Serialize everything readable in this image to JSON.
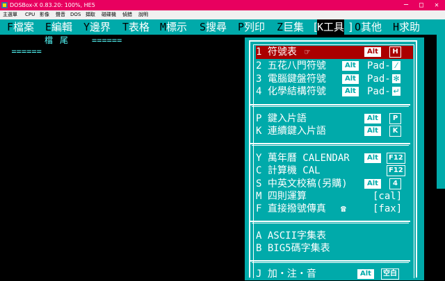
{
  "window": {
    "title": "DOSBox-X 0.83.20: 100%, HE5"
  },
  "menubar": {
    "items": [
      "主選單",
      "CPU",
      "影像",
      "聲音",
      "DOS",
      "擷取",
      "磁碟機",
      "偵錯",
      "說明"
    ]
  },
  "dos_menu": {
    "items": [
      {
        "hotkey": "F",
        "label": "檔案",
        "selected": false
      },
      {
        "hotkey": "E",
        "label": "編輯",
        "selected": false
      },
      {
        "hotkey": "Y",
        "label": "邊界",
        "selected": false
      },
      {
        "hotkey": "T",
        "label": "表格",
        "selected": false
      },
      {
        "hotkey": "M",
        "label": "標示",
        "selected": false
      },
      {
        "hotkey": "S",
        "label": "搜尋",
        "selected": false
      },
      {
        "hotkey": "P",
        "label": "列印",
        "selected": false
      },
      {
        "hotkey": "Z",
        "label": "巨集",
        "selected": false
      },
      {
        "hotkey": "K",
        "label": "工具",
        "selected": true
      },
      {
        "hotkey": "O",
        "label": "其他",
        "selected": false
      },
      {
        "hotkey": "H",
        "label": "求助",
        "selected": false
      }
    ],
    "open_bracket": "[",
    "close_bracket": "]"
  },
  "editor": {
    "eof_marks_left": "======",
    "eof_label": "檔尾",
    "eof_marks_right": "======"
  },
  "tools_menu": {
    "rows": [
      {
        "label": "1 符號表",
        "icon": "☞",
        "mod": "Alt",
        "key": "H",
        "selected": true
      },
      {
        "label": "2 五花八門符號",
        "mod": "Alt",
        "key": "Pad-",
        "pad": "⁄"
      },
      {
        "label": "3 電腦鍵盤符號",
        "mod": "Alt",
        "key": "Pad-",
        "pad": "✻"
      },
      {
        "label": "4 化學結構符號",
        "mod": "Alt",
        "key": "Pad-",
        "pad": "↵"
      },
      {
        "label": "P 鍵入片語",
        "mod": "Alt",
        "key": "P"
      },
      {
        "label": "K 連續鍵入片語",
        "mod": "Alt",
        "key": "K"
      },
      {
        "label": "Y 萬年曆 CALENDAR",
        "mod": "Alt",
        "key": "F12"
      },
      {
        "label": "C 計算機 CAL",
        "key": "F12"
      },
      {
        "label": "S 中英文校稿(另購)",
        "mod": "Alt",
        "key": "4"
      },
      {
        "label": "M 四則運算",
        "key": "[cal]"
      },
      {
        "label": "F 直接撥號傳真",
        "icon": "☎",
        "key": "[fax]"
      },
      {
        "label": "A ASCII字集表"
      },
      {
        "label": "B BIG5碼字集表"
      },
      {
        "label": "J 加‧注‧音",
        "mod": "Alt",
        "key": "空白"
      }
    ]
  }
}
